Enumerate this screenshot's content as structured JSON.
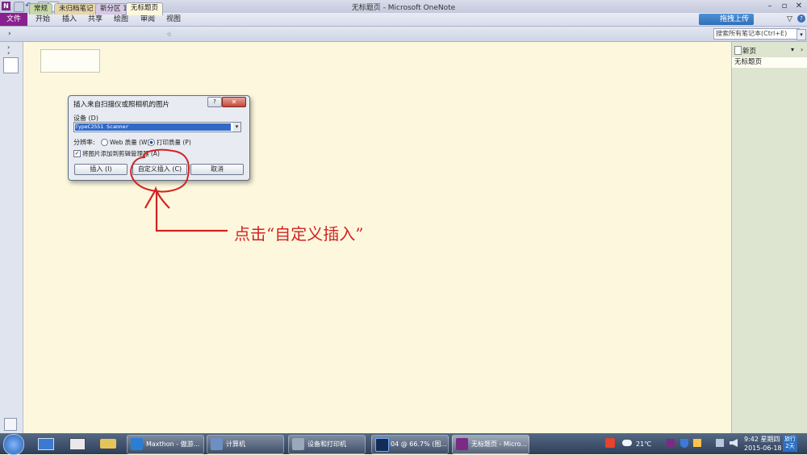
{
  "window": {
    "title": "无标题页 - Microsoft OneNote",
    "help_icon": "?"
  },
  "ribbon": {
    "file_tab": "文件",
    "tabs": [
      "开始",
      "插入",
      "共享",
      "绘图",
      "审阅",
      "视图"
    ],
    "upload_button": "拖拽上传"
  },
  "sections": {
    "tabs": [
      "常规",
      "未归档笔记",
      "新分区 1",
      "无标题页"
    ],
    "search_placeholder": "搜索所有笔记本(Ctrl+E)"
  },
  "page_panel": {
    "new_page": "新页",
    "pages": [
      "无标题页"
    ]
  },
  "dialog": {
    "title": "插入来自扫描仪或照相机的图片",
    "device_label": "设备 (D)",
    "device_value": "TypeC2551 Scanner",
    "resolution_label": "分辨率:",
    "option_web": "Web 质量 (W)",
    "option_print": "打印质量 (P)",
    "checkbox_label": "将图片添加到剪辑管理器 (A)",
    "btn_insert": "插入 (I)",
    "btn_custom": "自定义插入 (C)",
    "btn_cancel": "取消"
  },
  "annotation": {
    "text": "点击“自定义插入”",
    "color": "#d32222"
  },
  "taskbar": {
    "items": [
      {
        "label": "Maxthon - 傲游..."
      },
      {
        "label": "计算机"
      },
      {
        "label": "设备和打印机"
      },
      {
        "label": "04 @ 66.7% (图..."
      },
      {
        "label": "无标题页 - Micro..."
      }
    ],
    "temperature": "21℃",
    "time": "9:42 星期四",
    "date": "2015-06-18",
    "badge": "旅行\n2天"
  }
}
